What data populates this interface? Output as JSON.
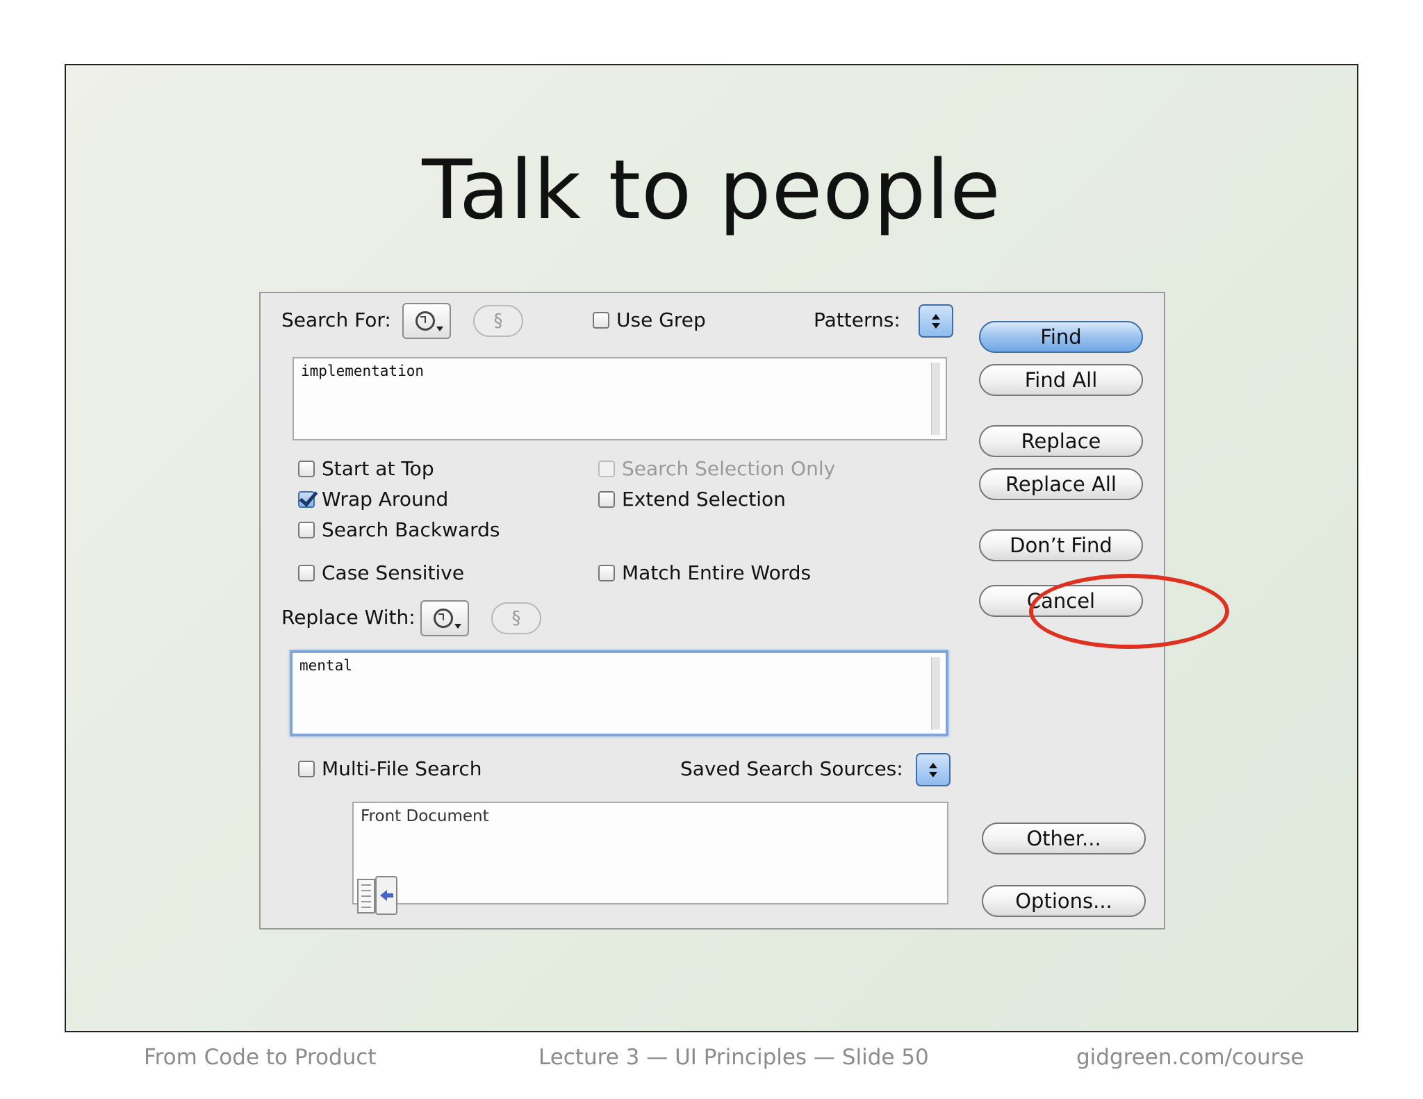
{
  "slide": {
    "title": "Talk to people",
    "footer_left": "From Code to Product",
    "footer_center": "Lecture 3 — UI Principles — Slide 50",
    "footer_right": "gidgreen.com/course"
  },
  "dialog": {
    "search_for_label": "Search For:",
    "section_symbol": "§",
    "use_grep_label": "Use Grep",
    "patterns_label": "Patterns:",
    "search_text": "implementation",
    "options": {
      "start_at_top": "Start at Top",
      "wrap_around": "Wrap Around",
      "search_backwards": "Search Backwards",
      "case_sensitive": "Case Sensitive",
      "search_selection_only": "Search Selection Only",
      "extend_selection": "Extend Selection",
      "match_entire_words": "Match Entire Words"
    },
    "replace_with_label": "Replace With:",
    "replace_text": "mental",
    "multi_file_label": "Multi-File Search",
    "saved_sources_label": "Saved Search Sources:",
    "sources_list": [
      "Front Document"
    ],
    "buttons": {
      "find": "Find",
      "find_all": "Find All",
      "replace": "Replace",
      "replace_all": "Replace All",
      "dont_find": "Don’t Find",
      "cancel": "Cancel",
      "other": "Other...",
      "options": "Options..."
    }
  },
  "colors": {
    "highlight_ellipse": "#e0301f",
    "default_button": "#6ea6e6"
  },
  "icons": [
    "clock-history-icon",
    "chevron-down-icon",
    "stepper-icon",
    "checkmark-icon",
    "add-source-arrow-icon"
  ]
}
